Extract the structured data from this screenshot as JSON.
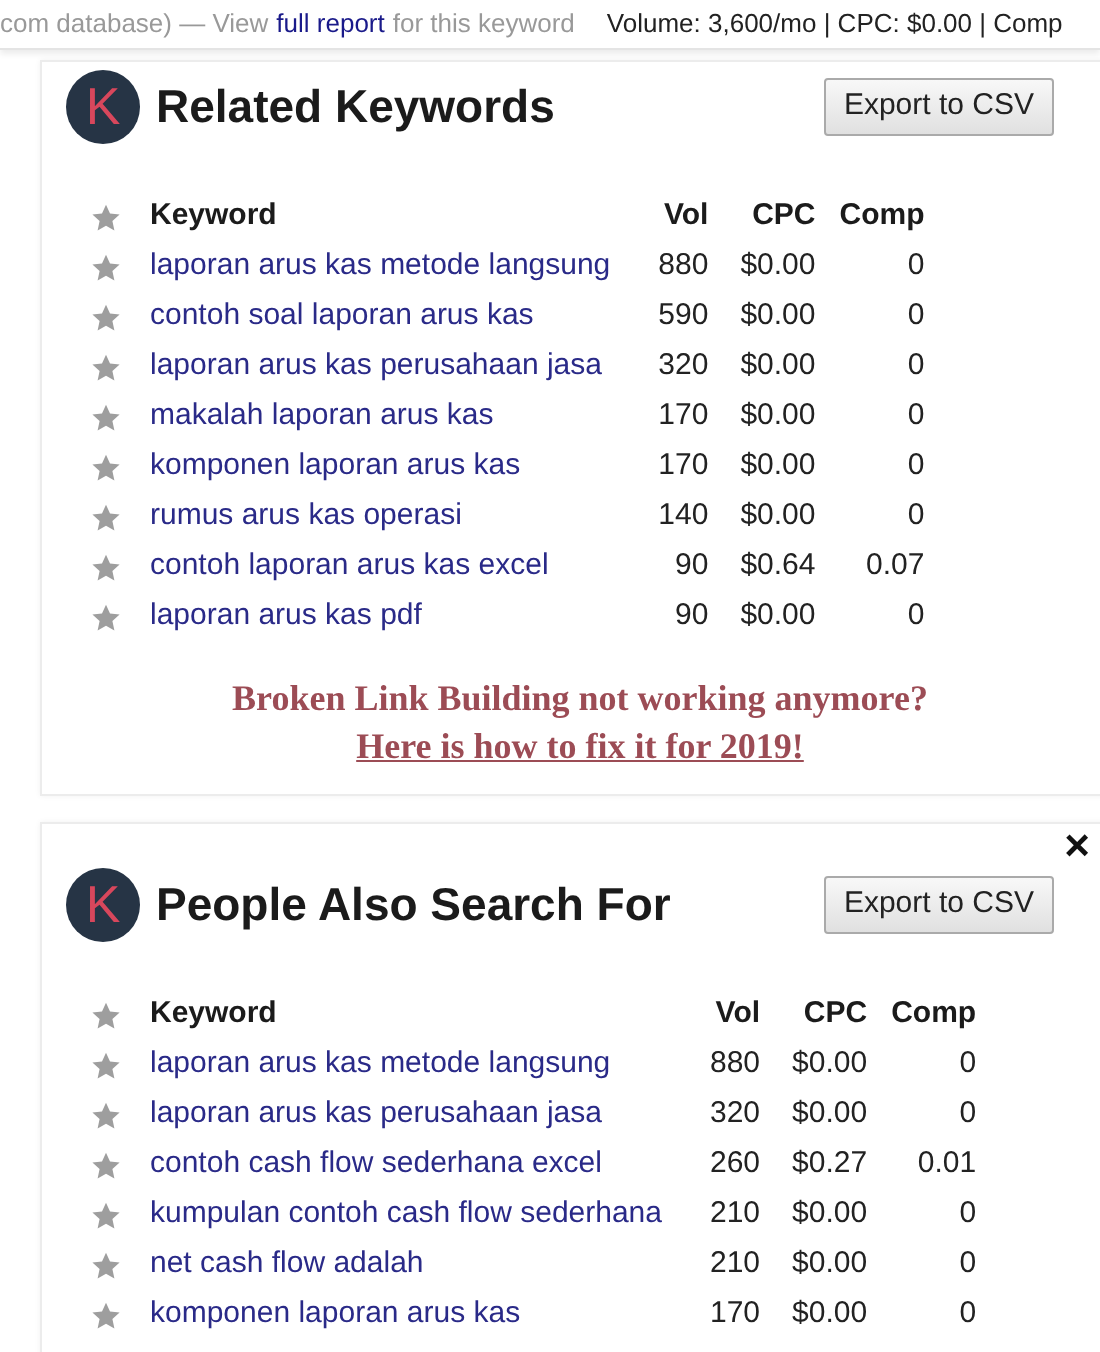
{
  "top_bar": {
    "prefix": "com database) — View",
    "link": "full report",
    "suffix": "for this keyword",
    "stats": "Volume: 3,600/mo | CPC: $0.00 | Comp"
  },
  "panels": [
    {
      "logo": "K",
      "title": "Related Keywords",
      "export_button": "Export to CSV",
      "columns": [
        "Keyword",
        "Vol",
        "CPC",
        "Comp"
      ],
      "rows": [
        {
          "keyword": "laporan arus kas metode langsung",
          "vol": "880",
          "cpc": "$0.00",
          "comp": "0"
        },
        {
          "keyword": "contoh soal laporan arus kas",
          "vol": "590",
          "cpc": "$0.00",
          "comp": "0"
        },
        {
          "keyword": "laporan arus kas perusahaan jasa",
          "vol": "320",
          "cpc": "$0.00",
          "comp": "0"
        },
        {
          "keyword": "makalah laporan arus kas",
          "vol": "170",
          "cpc": "$0.00",
          "comp": "0"
        },
        {
          "keyword": "komponen laporan arus kas",
          "vol": "170",
          "cpc": "$0.00",
          "comp": "0"
        },
        {
          "keyword": "rumus arus kas operasi",
          "vol": "140",
          "cpc": "$0.00",
          "comp": "0"
        },
        {
          "keyword": "contoh laporan arus kas excel",
          "vol": "90",
          "cpc": "$0.64",
          "comp": "0.07"
        },
        {
          "keyword": "laporan arus kas pdf",
          "vol": "90",
          "cpc": "$0.00",
          "comp": "0"
        }
      ],
      "promo": {
        "text": "Broken Link Building not working anymore?",
        "link": "Here is how to fix it for 2019!"
      }
    },
    {
      "close": "×",
      "logo": "K",
      "title": "People Also Search For",
      "export_button": "Export to CSV",
      "columns": [
        "Keyword",
        "Vol",
        "CPC",
        "Comp"
      ],
      "rows": [
        {
          "keyword": "laporan arus kas metode langsung",
          "vol": "880",
          "cpc": "$0.00",
          "comp": "0"
        },
        {
          "keyword": "laporan arus kas perusahaan jasa",
          "vol": "320",
          "cpc": "$0.00",
          "comp": "0"
        },
        {
          "keyword": "contoh cash flow sederhana excel",
          "vol": "260",
          "cpc": "$0.27",
          "comp": "0.01"
        },
        {
          "keyword": "kumpulan contoh cash flow sederhana",
          "vol": "210",
          "cpc": "$0.00",
          "comp": "0"
        },
        {
          "keyword": "net cash flow adalah",
          "vol": "210",
          "cpc": "$0.00",
          "comp": "0"
        },
        {
          "keyword": "komponen laporan arus kas",
          "vol": "170",
          "cpc": "$0.00",
          "comp": "0"
        }
      ]
    }
  ]
}
